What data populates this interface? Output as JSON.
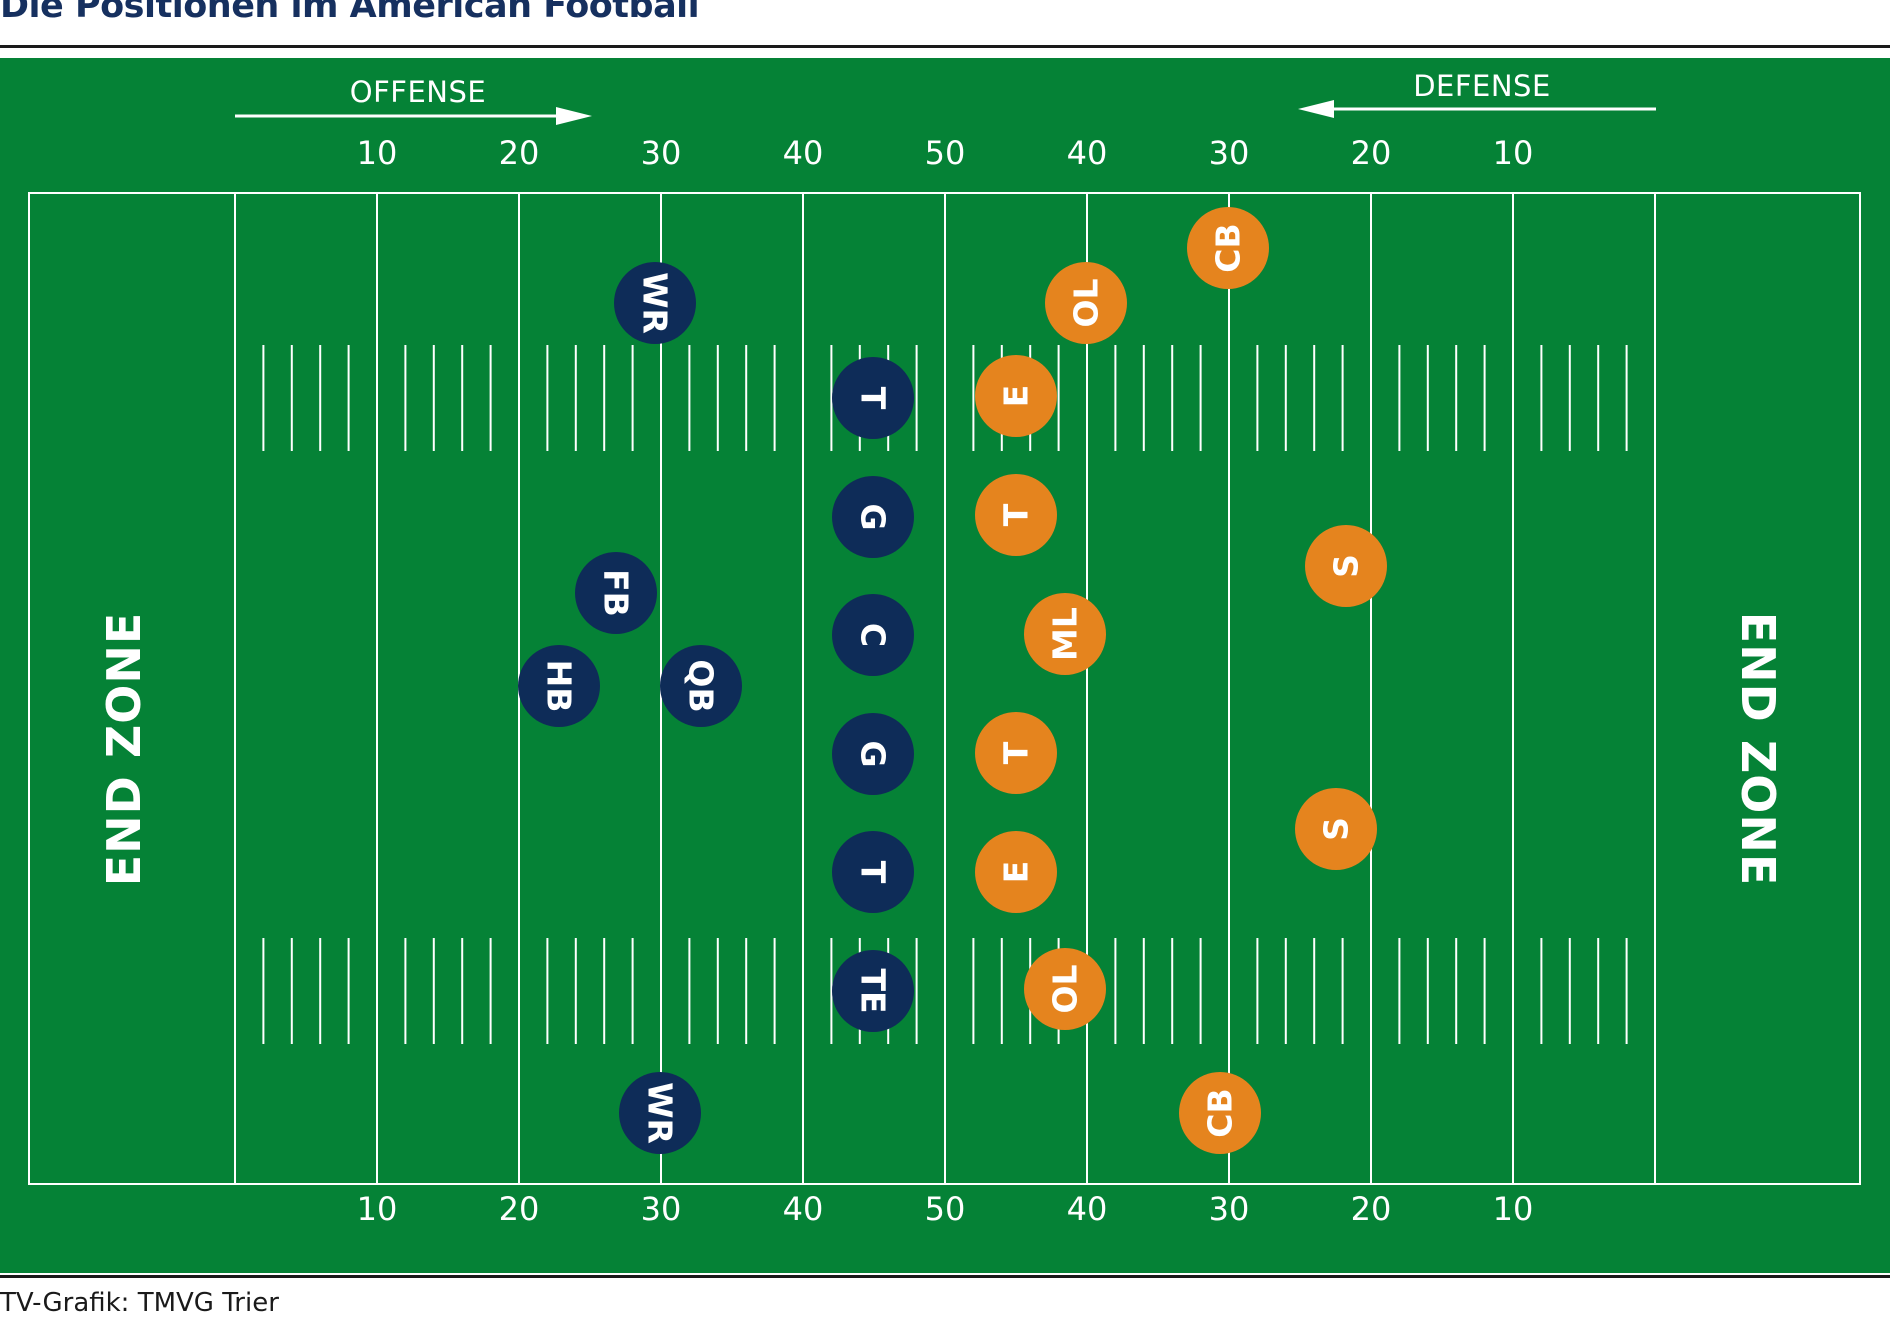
{
  "header": {
    "title": "Die Positionen im American Football"
  },
  "credit": "TV-Grafik: TMVG Trier",
  "colors": {
    "field": "#058236",
    "offense": "#0e2c58",
    "defense": "#e5841e",
    "lines": "#ffffff",
    "title": "#16305f"
  },
  "direction": {
    "offense": "OFFENSE",
    "defense": "DEFENSE"
  },
  "endzones": {
    "left": "END ZONE",
    "right": "END ZONE"
  },
  "yard_numbers": [
    "10",
    "20",
    "30",
    "40",
    "50",
    "40",
    "30",
    "20",
    "10"
  ],
  "offense": [
    {
      "label": "WR"
    },
    {
      "label": "T"
    },
    {
      "label": "G"
    },
    {
      "label": "C"
    },
    {
      "label": "G"
    },
    {
      "label": "T"
    },
    {
      "label": "TE"
    },
    {
      "label": "FB"
    },
    {
      "label": "HB"
    },
    {
      "label": "QB"
    },
    {
      "label": "WR"
    }
  ],
  "defense": [
    {
      "label": "CB"
    },
    {
      "label": "OL"
    },
    {
      "label": "E"
    },
    {
      "label": "T"
    },
    {
      "label": "ML"
    },
    {
      "label": "T"
    },
    {
      "label": "E"
    },
    {
      "label": "OL"
    },
    {
      "label": "S"
    },
    {
      "label": "S"
    },
    {
      "label": "CB"
    }
  ]
}
